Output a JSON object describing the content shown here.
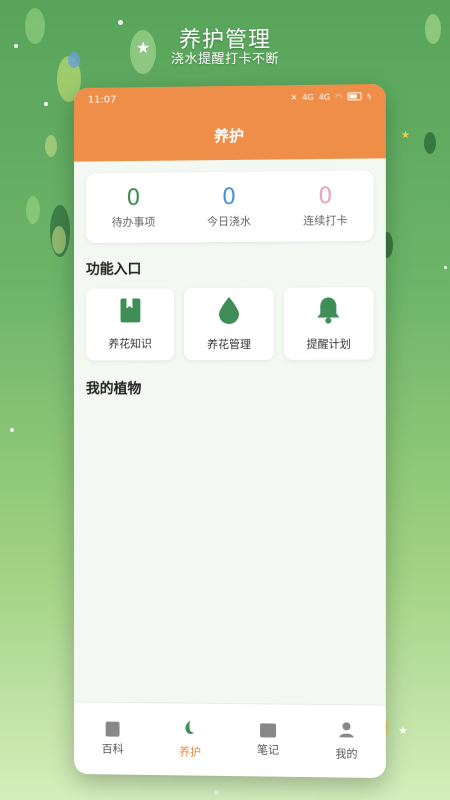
{
  "promo": {
    "title": "养护管理",
    "subtitle": "浇水提醒打卡不断"
  },
  "statusbar": {
    "time": "11:07",
    "net1": "4G",
    "net2": "4G"
  },
  "header": {
    "title": "养护"
  },
  "stats": [
    {
      "value": "0",
      "label": "待办事项",
      "color": "#3d8b4f"
    },
    {
      "value": "0",
      "label": "今日浇水",
      "color": "#4a90d9"
    },
    {
      "value": "0",
      "label": "连续打卡",
      "color": "#eaa0b8"
    }
  ],
  "sections": {
    "features_title": "功能入口",
    "plants_title": "我的植物"
  },
  "features": [
    {
      "label": "养花知识",
      "icon": "book-icon"
    },
    {
      "label": "养花管理",
      "icon": "water-drop-icon"
    },
    {
      "label": "提醒计划",
      "icon": "bell-icon"
    }
  ],
  "tabs": [
    {
      "label": "百科",
      "icon": "book-tab-icon",
      "active": false
    },
    {
      "label": "养护",
      "icon": "leaf-tab-icon",
      "active": true
    },
    {
      "label": "笔记",
      "icon": "note-tab-icon",
      "active": false
    },
    {
      "label": "我的",
      "icon": "person-tab-icon",
      "active": false
    }
  ],
  "colors": {
    "accent": "#ee8e48",
    "icon_green": "#3f8e58",
    "active_tab": "#e58a3f"
  }
}
